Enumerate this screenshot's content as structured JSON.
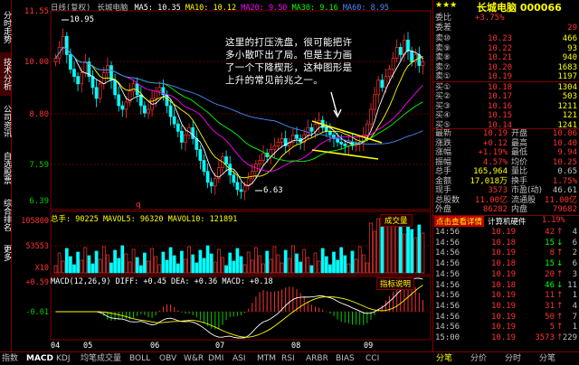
{
  "header": {
    "period": "日线(复权)",
    "stock": "长城电脑",
    "ma5": "MA5: 10.35",
    "ma10": "MA10: 10.12",
    "ma20": "MA20: 9.50",
    "ma30": "MA30: 9.16",
    "ma60": "MA60: 8.95"
  },
  "sidebar": [
    "分时走势",
    "技术分析",
    "公司资讯",
    "自选股票",
    "综合排名",
    "更多"
  ],
  "price_axis": [
    "11.55",
    "10.00",
    "8.80",
    "7.59",
    "6.39"
  ],
  "annotations": {
    "high_label": "10.95",
    "low_label": "6.63",
    "q_marker": "q",
    "comment": "这里的打压洗盘，很可能把许多小散吓出了局。但是主力画了一个下降楔形，这种图形是上升的常见前兆之一。"
  },
  "volume": {
    "header": "总手: 90225  MAVOL5: 96320  MAVOL10: 121891",
    "box_label": "成交量",
    "axis": [
      "105800",
      "53553",
      "X10"
    ]
  },
  "macd": {
    "header": "MACD(12,26,9)  DIFF: +0.45  DEA: +0.36  MACD: +0.18",
    "box_label": "指标说明",
    "axis": [
      "+0.59",
      "-0.01"
    ]
  },
  "date_axis": [
    "04",
    "05",
    "06",
    "07",
    "08",
    "09"
  ],
  "quote": {
    "title": "长城电脑 000066",
    "stars": "★★★",
    "weibi_label": "委比",
    "weibi_value": "+3.75%",
    "weicha_label": "委差",
    "weicha_value": "29",
    "sell": [
      {
        "label": "卖⑩",
        "price": "10.23",
        "vol": "466"
      },
      {
        "label": "卖⑨",
        "price": "10.22",
        "vol": "93"
      },
      {
        "label": "卖⑧",
        "price": "10.21",
        "vol": "940"
      },
      {
        "label": "卖⑦",
        "price": "10.20",
        "vol": "1683"
      },
      {
        "label": "卖①",
        "price": "10.19",
        "vol": "1197"
      }
    ],
    "buy": [
      {
        "label": "买①",
        "price": "10.18",
        "vol": "1304"
      },
      {
        "label": "买②",
        "price": "10.17",
        "vol": "503"
      },
      {
        "label": "买③",
        "price": "10.16",
        "vol": "1211"
      },
      {
        "label": "买④",
        "price": "10.15",
        "vol": "121"
      },
      {
        "label": "买⑤",
        "price": "10.14",
        "vol": "1241"
      }
    ],
    "stats": [
      {
        "l1": "最新",
        "v1": "10.19",
        "l2": "开盘",
        "v2": "10.06"
      },
      {
        "l1": "涨跌",
        "v1": "+0.12",
        "l2": "最高",
        "v2": "10.40"
      },
      {
        "l1": "涨幅",
        "v1": "+1.19%",
        "l2": "最低",
        "v2": "9.94"
      },
      {
        "l1": "振幅",
        "v1": "4.57%",
        "l2": "均价",
        "v2": "10.25"
      },
      {
        "l1": "总手",
        "v1": "165,964",
        "l2": "量比",
        "v2": "0.65"
      },
      {
        "l1": "金额",
        "v1": "17,018万",
        "l2": "换手",
        "v2": "1.75%"
      },
      {
        "l1": "现手",
        "v1": "3573",
        "l2": "市盈(动)",
        "v2": "46.61"
      },
      {
        "l1": "总股数",
        "v1": "11.00亿",
        "l2": "流通股",
        "v2": "11.00亿"
      },
      {
        "l1": "外盘",
        "v1": "86282",
        "l2": "内盘",
        "v2": "79682"
      }
    ],
    "ticks_header_left": "点击查看详情",
    "ticks_header_mid": "计算机硬件",
    "ticks_header_right": "1.19%",
    "ticks": [
      {
        "t": "14:56",
        "p": "10.19",
        "v": "42",
        "d": "4"
      },
      {
        "t": "14:56",
        "p": "10.18",
        "v": "15",
        "d": "6"
      },
      {
        "t": "14:56",
        "p": "10.19",
        "v": "8",
        "d": "2"
      },
      {
        "t": "14:56",
        "p": "10.18",
        "v": "15",
        "d": "6"
      },
      {
        "t": "14:56",
        "p": "10.19",
        "v": "20",
        "d": "3"
      },
      {
        "t": "14:56",
        "p": "10.18",
        "v": "46",
        "d": "11"
      },
      {
        "t": "14:56",
        "p": "10.19",
        "v": "11",
        "d": "1"
      },
      {
        "t": "14:56",
        "p": "10.19",
        "v": "31",
        "d": "4"
      },
      {
        "t": "14:56",
        "p": "10.19",
        "v": "50",
        "d": "7"
      },
      {
        "t": "14:56",
        "p": "10.19",
        "v": "5",
        "d": "1"
      },
      {
        "t": "15:00",
        "p": "10.19",
        "v": "3573",
        "d": "229"
      }
    ]
  },
  "tabs": [
    "指数",
    "MACD",
    "KDJ",
    "均笔成交量",
    "BOLL",
    "OBV",
    "W&R",
    "DMI",
    "ASI",
    "MTM",
    "RSI",
    "ARBR",
    "BIAS",
    "CCI"
  ],
  "bottom_right_tabs": [
    "分笔",
    "分价",
    "分时",
    "分笔"
  ],
  "colors": {
    "up": "#ff3232",
    "down": "#00ffff",
    "ma5": "#ffffff",
    "ma10": "#ffff00",
    "ma20": "#ff00ff",
    "ma30": "#00ff00",
    "ma60": "#4a8aff",
    "frame": "#800000"
  }
}
